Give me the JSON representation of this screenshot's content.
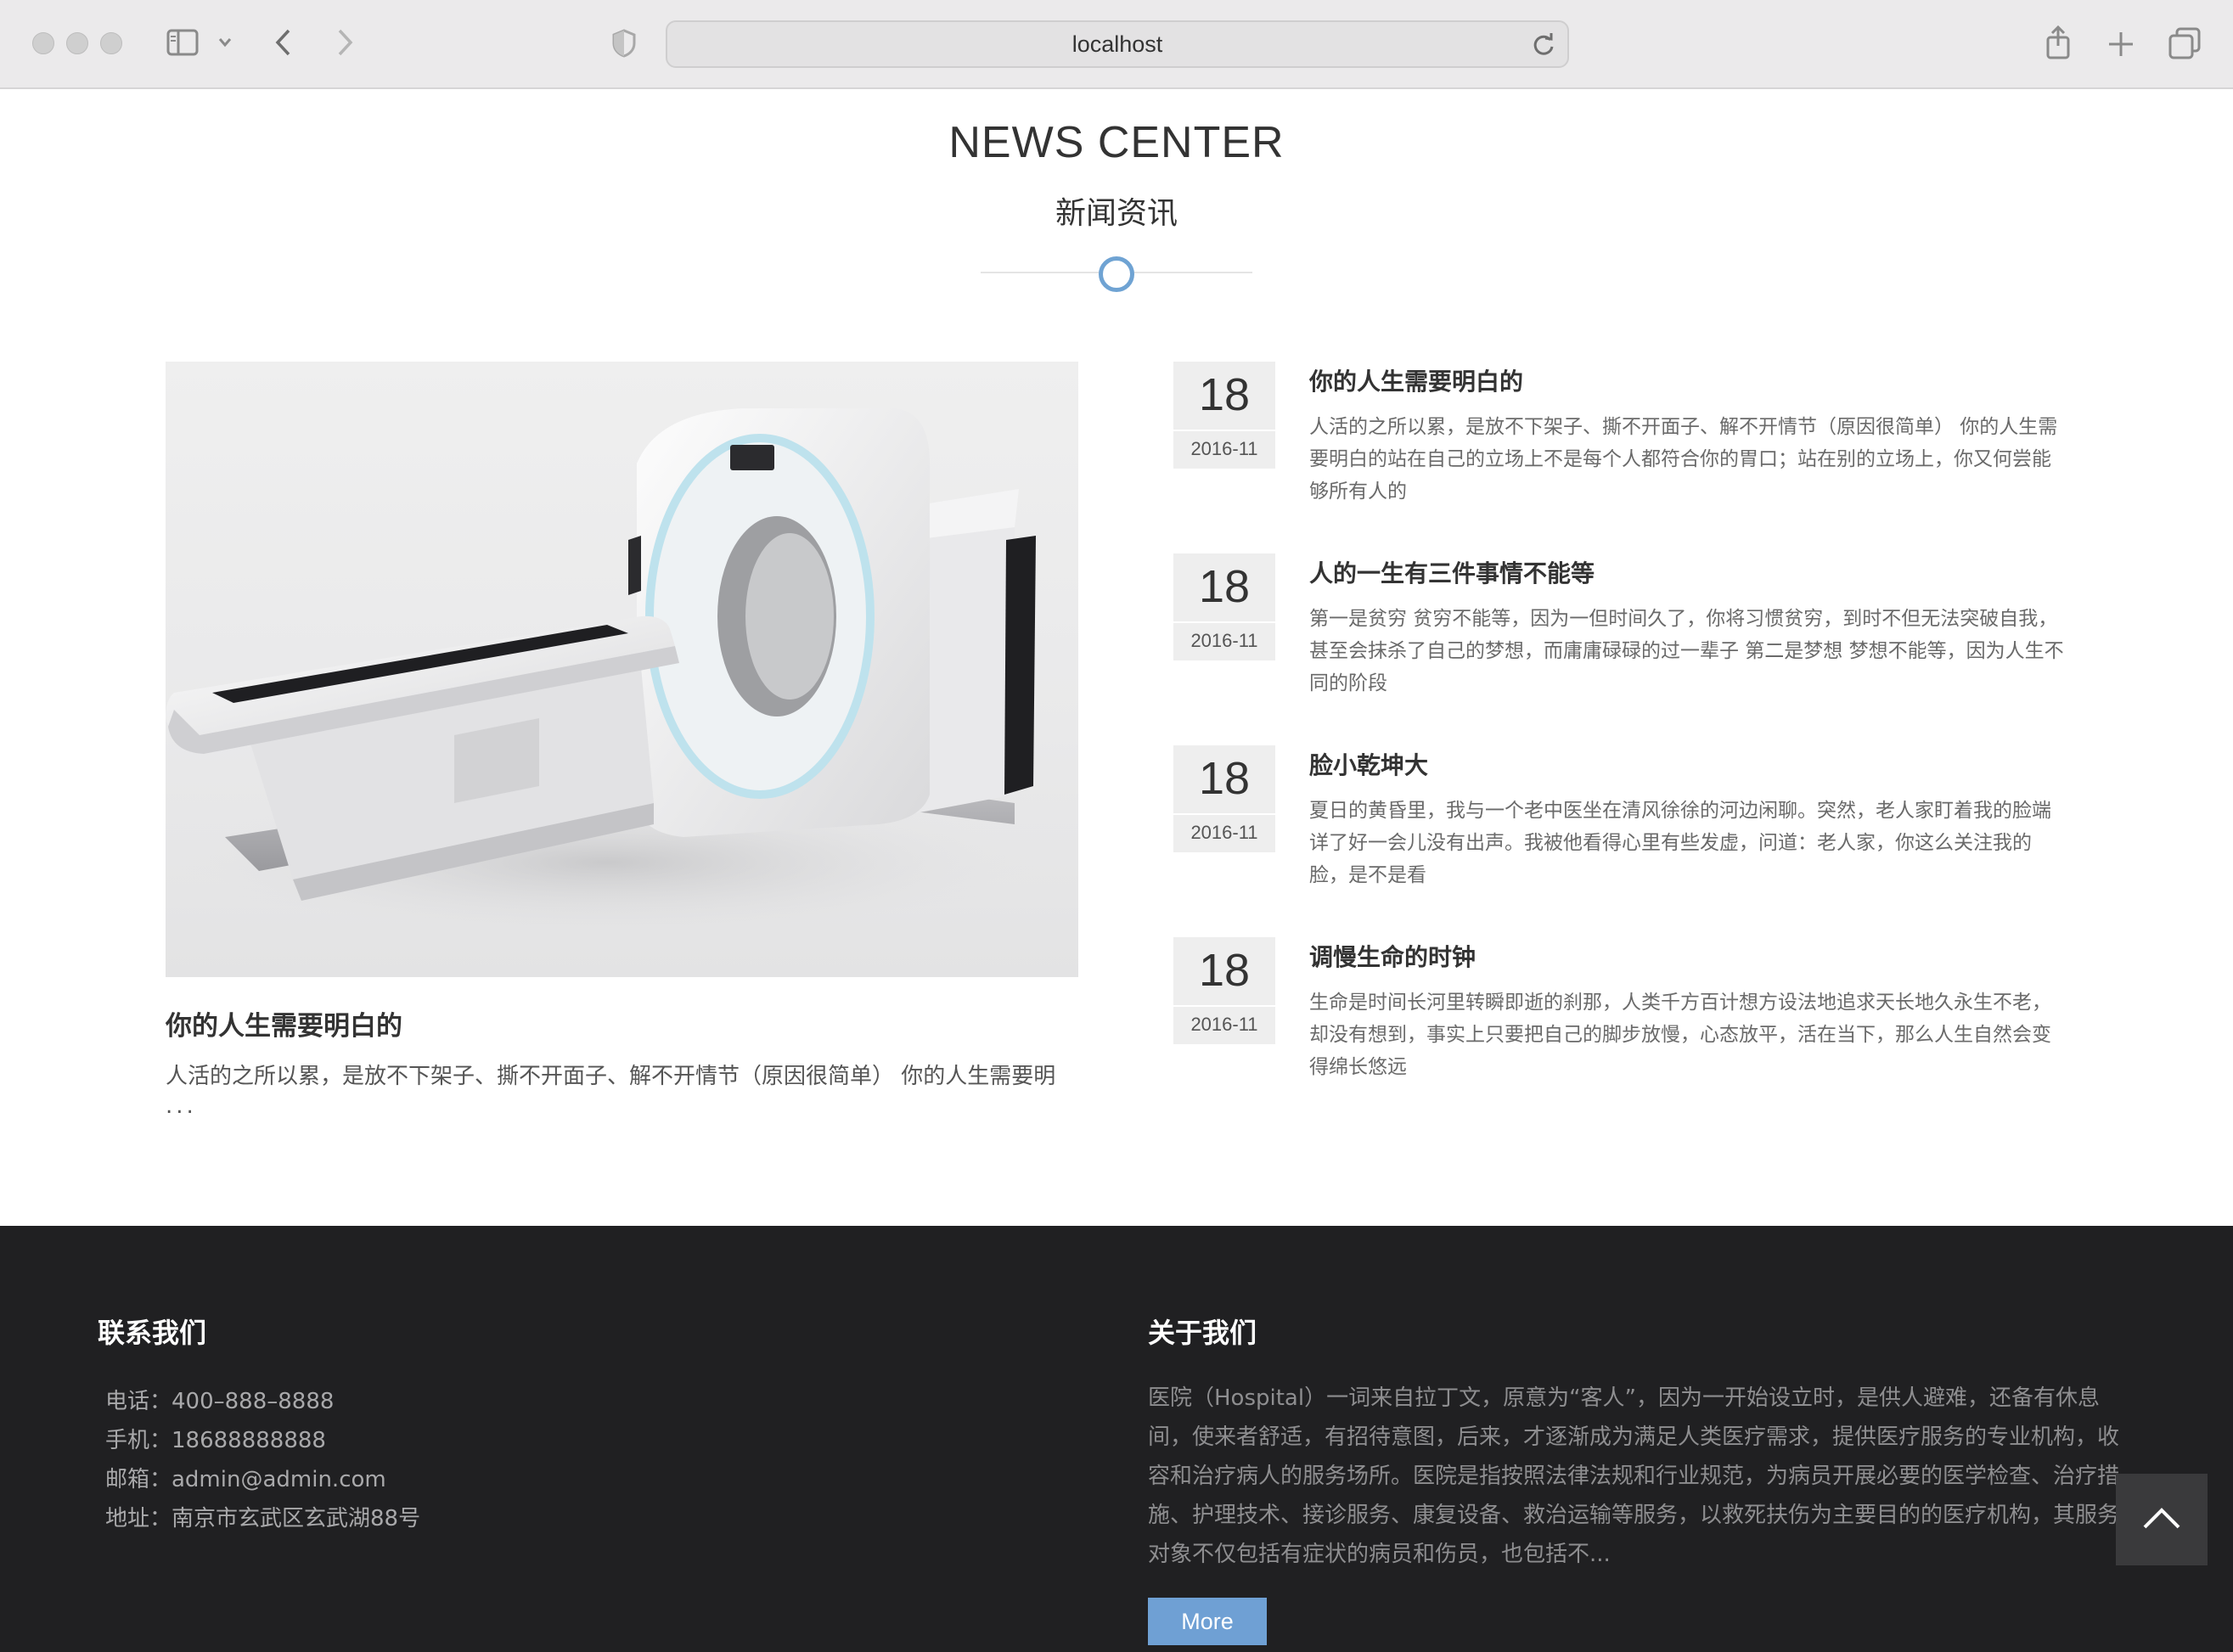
{
  "browser": {
    "url": "localhost"
  },
  "section": {
    "title_en": "NEWS CENTER",
    "title_cn": "新闻资讯",
    "accent_color": "#6fa3d3"
  },
  "feature": {
    "image_alt": "CT scanner",
    "title": "你的人生需要明白的",
    "excerpt": "人活的之所以累，是放不下架子、撕不开面子、解不开情节（原因很简单） 你的人生需要明",
    "ellipsis": "..."
  },
  "news": [
    {
      "day": "18",
      "ym": "2016-11",
      "title": "你的人生需要明白的",
      "text": "人活的之所以累，是放不下架子、撕不开面子、解不开情节（原因很简单） 你的人生需要明白的站在自己的立场上不是每个人都符合你的胃口；站在别的立场上，你又何尝能够所有人的"
    },
    {
      "day": "18",
      "ym": "2016-11",
      "title": "人的一生有三件事情不能等",
      "text": "第一是贫穷 贫穷不能等，因为一但时间久了，你将习惯贫穷，到时不但无法突破自我，甚至会抹杀了自己的梦想，而庸庸碌碌的过一辈子 第二是梦想 梦想不能等，因为人生不同的阶段"
    },
    {
      "day": "18",
      "ym": "2016-11",
      "title": "脸小乾坤大",
      "text": "夏日的黄昏里，我与一个老中医坐在清风徐徐的河边闲聊。突然，老人家盯着我的脸端详了好一会儿没有出声。我被他看得心里有些发虚，问道：老人家，你这么关注我的脸，是不是看"
    },
    {
      "day": "18",
      "ym": "2016-11",
      "title": "调慢生命的时钟",
      "text": "生命是时间长河里转瞬即逝的刹那，人类千方百计想方设法地追求天长地久永生不老，却没有想到，事实上只要把自己的脚步放慢，心态放平，活在当下，那么人生自然会变得绵长悠远"
    }
  ],
  "footer": {
    "contact_title": "联系我们",
    "contact": {
      "phone": "电话：400–888–8888",
      "mobile": "手机：18688888888",
      "email": "邮箱：admin@admin.com",
      "address": "地址：南京市玄武区玄武湖88号"
    },
    "about_title": "关于我们",
    "about_text": "医院（Hospital）一词来自拉丁文，原意为“客人”，因为一开始设立时，是供人避难，还备有休息间，使来者舒适，有招待意图，后来，才逐渐成为满足人类医疗需求，提供医疗服务的专业机构，收容和治疗病人的服务场所。医院是指按照法律法规和行业规范，为病员开展必要的医学检查、治疗措施、护理技术、接诊服务、康复设备、救治运输等服务，以救死扶伤为主要目的的医疗机构，其服务对象不仅包括有症状的病员和伤员，也包括不...",
    "more_label": "More",
    "background": "#202022"
  }
}
